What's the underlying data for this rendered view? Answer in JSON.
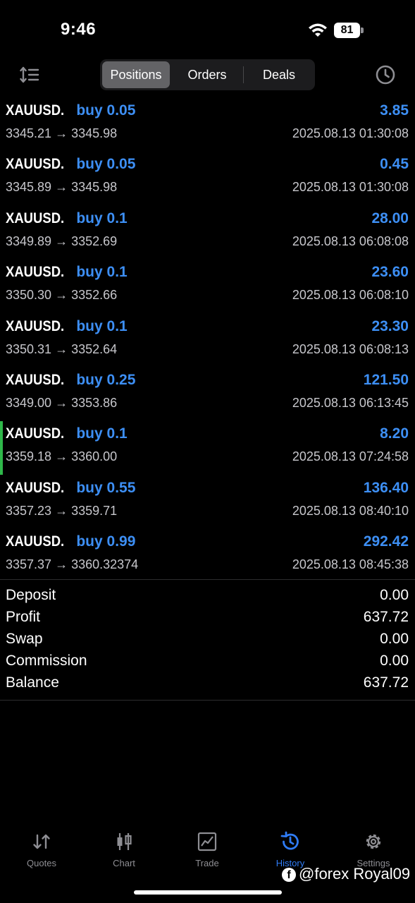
{
  "status_bar": {
    "time": "9:46",
    "battery": "81"
  },
  "segments": [
    "Positions",
    "Orders",
    "Deals"
  ],
  "deals": [
    {
      "symbol": "XAUUSD.",
      "type_volume": "buy 0.05",
      "profit": "3.85",
      "prices": "3345.21 → 3345.98",
      "time": "2025.08.13 01:30:08",
      "highlight": false
    },
    {
      "symbol": "XAUUSD.",
      "type_volume": "buy 0.05",
      "profit": "0.45",
      "prices": "3345.89 → 3345.98",
      "time": "2025.08.13 01:30:08",
      "highlight": false
    },
    {
      "symbol": "XAUUSD.",
      "type_volume": "buy 0.1",
      "profit": "28.00",
      "prices": "3349.89 → 3352.69",
      "time": "2025.08.13 06:08:08",
      "highlight": false
    },
    {
      "symbol": "XAUUSD.",
      "type_volume": "buy 0.1",
      "profit": "23.60",
      "prices": "3350.30 → 3352.66",
      "time": "2025.08.13 06:08:10",
      "highlight": false
    },
    {
      "symbol": "XAUUSD.",
      "type_volume": "buy 0.1",
      "profit": "23.30",
      "prices": "3350.31 → 3352.64",
      "time": "2025.08.13 06:08:13",
      "highlight": false
    },
    {
      "symbol": "XAUUSD.",
      "type_volume": "buy 0.25",
      "profit": "121.50",
      "prices": "3349.00 → 3353.86",
      "time": "2025.08.13 06:13:45",
      "highlight": false
    },
    {
      "symbol": "XAUUSD.",
      "type_volume": "buy 0.1",
      "profit": "8.20",
      "prices": "3359.18 → 3360.00",
      "time": "2025.08.13 07:24:58",
      "highlight": true
    },
    {
      "symbol": "XAUUSD.",
      "type_volume": "buy 0.55",
      "profit": "136.40",
      "prices": "3357.23 → 3359.71",
      "time": "2025.08.13 08:40:10",
      "highlight": false
    },
    {
      "symbol": "XAUUSD.",
      "type_volume": "buy 0.99",
      "profit": "292.42",
      "prices": "3357.37 → 3360.32374",
      "time": "2025.08.13 08:45:38",
      "highlight": false
    }
  ],
  "summary": [
    {
      "label": "Deposit",
      "value": "0.00"
    },
    {
      "label": "Profit",
      "value": "637.72"
    },
    {
      "label": "Swap",
      "value": "0.00"
    },
    {
      "label": "Commission",
      "value": "0.00"
    },
    {
      "label": "Balance",
      "value": "637.72"
    }
  ],
  "tabs": [
    {
      "label": "Quotes",
      "icon": "quotes-icon",
      "active": false
    },
    {
      "label": "Chart",
      "icon": "chart-icon",
      "active": false
    },
    {
      "label": "Trade",
      "icon": "trade-icon",
      "active": false
    },
    {
      "label": "History",
      "icon": "history-icon",
      "active": true
    },
    {
      "label": "Settings",
      "icon": "settings-icon",
      "active": false
    }
  ],
  "watermark": "@forex Royal09",
  "colors": {
    "accent": "#3d8ff5",
    "highlight_bar": "#2fb84a",
    "active_tab": "#2f7cf6"
  }
}
